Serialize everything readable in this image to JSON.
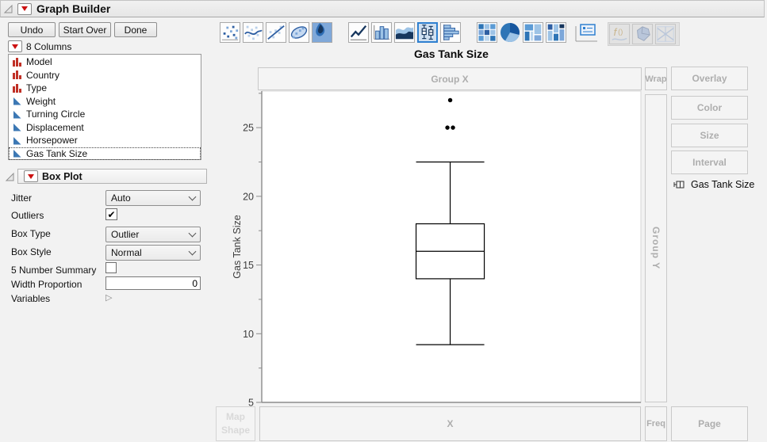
{
  "window": {
    "title": "Graph Builder"
  },
  "action_buttons": {
    "undo": "Undo",
    "start_over": "Start Over",
    "done": "Done"
  },
  "columns_panel": {
    "header": "8 Columns",
    "items": [
      {
        "label": "Model",
        "role": "nominal",
        "selected": false
      },
      {
        "label": "Country",
        "role": "nominal",
        "selected": false
      },
      {
        "label": "Type",
        "role": "nominal",
        "selected": false
      },
      {
        "label": "Weight",
        "role": "continuous",
        "selected": false
      },
      {
        "label": "Turning Circle",
        "role": "continuous",
        "selected": false
      },
      {
        "label": "Displacement",
        "role": "continuous",
        "selected": false
      },
      {
        "label": "Horsepower",
        "role": "continuous",
        "selected": false
      },
      {
        "label": "Gas Tank Size",
        "role": "continuous",
        "selected": true
      }
    ]
  },
  "boxplot_panel": {
    "title": "Box Plot",
    "jitter_label": "Jitter",
    "jitter_value": "Auto",
    "outliers_label": "Outliers",
    "outliers_checked": true,
    "box_type_label": "Box Type",
    "box_type_value": "Outlier",
    "box_style_label": "Box Style",
    "box_style_value": "Normal",
    "five_number_label": "5 Number Summary",
    "five_number_checked": false,
    "width_proportion_label": "Width Proportion",
    "width_proportion_value": "0",
    "variables_label": "Variables"
  },
  "element_toolbar": {
    "icons": [
      "points",
      "smoother",
      "line-of-fit",
      "ellipse",
      "contour",
      "line",
      "bar",
      "area",
      "box-plot",
      "histogram",
      "heatmap",
      "pie",
      "treemap",
      "mosaic",
      "caption-box",
      "formula",
      "map-shapes",
      "parallel"
    ],
    "selected": "box-plot",
    "disabled": [
      "formula",
      "map-shapes",
      "parallel"
    ]
  },
  "drop_zones": {
    "group_x": "Group X",
    "wrap": "Wrap",
    "overlay": "Overlay",
    "color": "Color",
    "size": "Size",
    "interval": "Interval",
    "group_y": "Group Y",
    "map_shape": "Map Shape",
    "x": "X",
    "freq": "Freq",
    "page": "Page"
  },
  "legend": {
    "items": [
      {
        "label": "Gas Tank Size",
        "glyph": "box-plot-marker"
      }
    ]
  },
  "chart_data": {
    "type": "box",
    "title": "Gas Tank Size",
    "ylabel": "Gas Tank Size",
    "xlabel": "",
    "ylim": [
      5,
      27.66
    ],
    "yticks_major": [
      5,
      10,
      15,
      20,
      25
    ],
    "yticks_minor": [
      7.5,
      12.5,
      17.5,
      22.5,
      27.5
    ],
    "grid": false,
    "series": [
      {
        "name": "Gas Tank Size",
        "whisker_low": 9.2,
        "q1": 14,
        "median": 16,
        "q3": 18,
        "whisker_high": 22.5,
        "outliers": [
          25,
          25,
          27
        ]
      }
    ]
  },
  "colors": {
    "accent_blue": "#2e5fa3",
    "selected_icon_border": "#2f80d0",
    "red_triangle": "#cc1111",
    "nominal_icon": "#c03026",
    "continuous_icon": "#3c78b4",
    "zone_text": "#aeaeae",
    "axis": "#8c8c8c"
  }
}
